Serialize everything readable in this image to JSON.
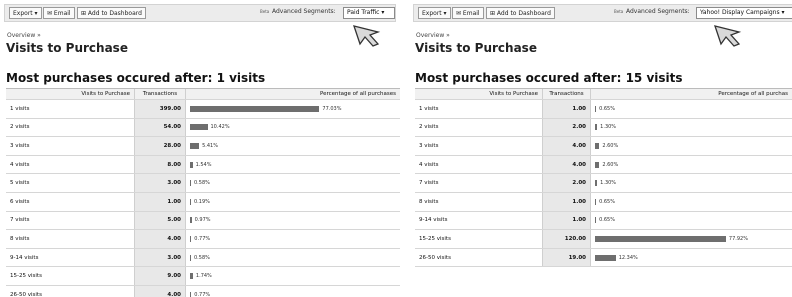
{
  "left": {
    "toolbar": {
      "export_label": "Export ▾",
      "email_label": "✉ Email",
      "dashboard_label": "⊞ Add to Dashboard",
      "beta": "Beta",
      "segments_label": "Advanced Segments:",
      "segment_value": "Paid Traffic ▾"
    },
    "breadcrumb": "Overview »",
    "title": "Visits to Purchase",
    "headline": "Most purchases occured after: 1 visits",
    "columns": [
      "Visits to Purchase",
      "Transactions",
      "Percentage of all purchases"
    ],
    "rows": [
      {
        "visits": "1 visits",
        "transactions": "399.00",
        "percentage": "77.03%",
        "pct": 77.03
      },
      {
        "visits": "2 visits",
        "transactions": "54.00",
        "percentage": "10.42%",
        "pct": 10.42
      },
      {
        "visits": "3 visits",
        "transactions": "28.00",
        "percentage": "5.41%",
        "pct": 5.41
      },
      {
        "visits": "4 visits",
        "transactions": "8.00",
        "percentage": "1.54%",
        "pct": 1.54
      },
      {
        "visits": "5 visits",
        "transactions": "3.00",
        "percentage": "0.58%",
        "pct": 0.58
      },
      {
        "visits": "6 visits",
        "transactions": "1.00",
        "percentage": "0.19%",
        "pct": 0.19
      },
      {
        "visits": "7 visits",
        "transactions": "5.00",
        "percentage": "0.97%",
        "pct": 0.97
      },
      {
        "visits": "8 visits",
        "transactions": "4.00",
        "percentage": "0.77%",
        "pct": 0.77
      },
      {
        "visits": "9-14 visits",
        "transactions": "3.00",
        "percentage": "0.58%",
        "pct": 0.58
      },
      {
        "visits": "15-25 visits",
        "transactions": "9.00",
        "percentage": "1.74%",
        "pct": 1.74
      },
      {
        "visits": "26-50 visits",
        "transactions": "4.00",
        "percentage": "0.77%",
        "pct": 0.77
      }
    ]
  },
  "right": {
    "toolbar": {
      "export_label": "Export ▾",
      "email_label": "✉ Email",
      "dashboard_label": "⊞ Add to Dashboard",
      "beta": "Beta",
      "segments_label": "Advanced Segments:",
      "segment_value": "Yahoo! Display Campaigns ▾"
    },
    "breadcrumb": "Overview »",
    "title": "Visits to Purchase",
    "headline": "Most purchases occured after: 15 visits",
    "columns": [
      "Visits to Purchase",
      "Transactions",
      "Percentage of all purchas"
    ],
    "rows": [
      {
        "visits": "1 visits",
        "transactions": "1.00",
        "percentage": "0.65%",
        "pct": 0.65
      },
      {
        "visits": "2 visits",
        "transactions": "2.00",
        "percentage": "1.30%",
        "pct": 1.3
      },
      {
        "visits": "3 visits",
        "transactions": "4.00",
        "percentage": "2.60%",
        "pct": 2.6
      },
      {
        "visits": "4 visits",
        "transactions": "4.00",
        "percentage": "2.60%",
        "pct": 2.6
      },
      {
        "visits": "7 visits",
        "transactions": "2.00",
        "percentage": "1.30%",
        "pct": 1.3
      },
      {
        "visits": "8 visits",
        "transactions": "1.00",
        "percentage": "0.65%",
        "pct": 0.65
      },
      {
        "visits": "9-14 visits",
        "transactions": "1.00",
        "percentage": "0.65%",
        "pct": 0.65
      },
      {
        "visits": "15-25 visits",
        "transactions": "120.00",
        "percentage": "77.92%",
        "pct": 77.92
      },
      {
        "visits": "26-50 visits",
        "transactions": "19.00",
        "percentage": "12.34%",
        "pct": 12.34
      }
    ]
  },
  "colors": {
    "bar": "#6e6e6e",
    "arrow_fill": "#d9d9d9",
    "arrow_stroke": "#333333"
  },
  "icons": {
    "pointer": "arrow-pointer-icon"
  }
}
